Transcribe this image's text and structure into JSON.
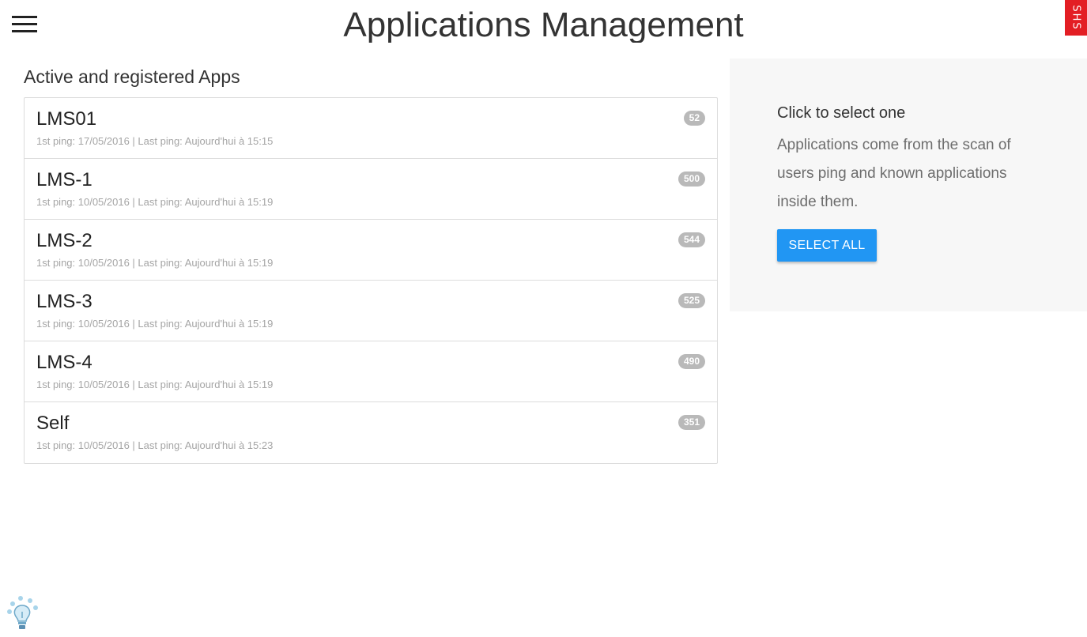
{
  "header": {
    "title": "Applications Management",
    "menu_icon": "hamburger-menu-icon",
    "brand_logo": "SHS"
  },
  "apps": {
    "section_title": "Active and registered Apps",
    "items": [
      {
        "name": "LMS01",
        "meta": "1st ping: 17/05/2016 |  Last ping: Aujourd'hui à 15:15",
        "count": "52"
      },
      {
        "name": "LMS-1",
        "meta": "1st ping: 10/05/2016 |  Last ping: Aujourd'hui à 15:19",
        "count": "500"
      },
      {
        "name": "LMS-2",
        "meta": "1st ping: 10/05/2016 |  Last ping: Aujourd'hui à 15:19",
        "count": "544"
      },
      {
        "name": "LMS-3",
        "meta": "1st ping: 10/05/2016 |  Last ping: Aujourd'hui à 15:19",
        "count": "525"
      },
      {
        "name": "LMS-4",
        "meta": "1st ping: 10/05/2016 |  Last ping: Aujourd'hui à 15:19",
        "count": "490"
      },
      {
        "name": "Self",
        "meta": "1st ping: 10/05/2016 |  Last ping: Aujourd'hui à 15:23",
        "count": "351"
      }
    ]
  },
  "info": {
    "title": "Click to select one",
    "text": "Applications come from the scan of users ping and known applications inside them.",
    "select_all_label": "SELECT ALL"
  },
  "footer": {
    "help_icon": "lightbulb-icon"
  },
  "colors": {
    "accent": "#2196f3",
    "brand": "#e31e24",
    "badge": "#b9b9b9",
    "panel_bg": "#f7f7f7"
  }
}
